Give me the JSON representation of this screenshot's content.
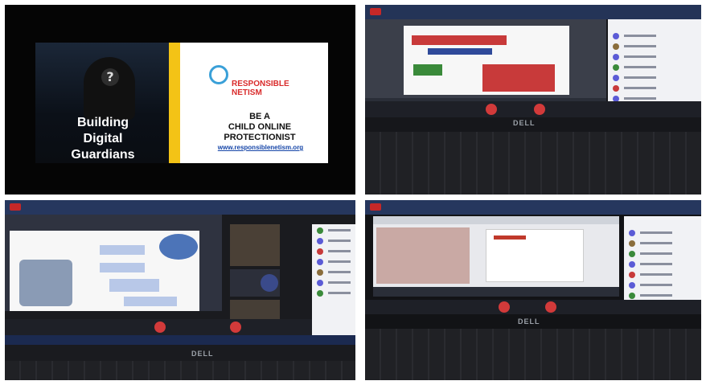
{
  "slide_top_left": {
    "left_text": [
      "Building",
      "Digital",
      "Guardians"
    ],
    "brand": [
      "RESPONSIBLE",
      "NETISM"
    ],
    "headline": [
      "BE A",
      "CHILD ONLINE",
      "PROTECTIONIST"
    ],
    "url": "www.responsiblenetism.org"
  },
  "colors": {
    "yellow": "#f3c316",
    "brand_red": "#d92b2b",
    "link_blue": "#1646a8"
  }
}
